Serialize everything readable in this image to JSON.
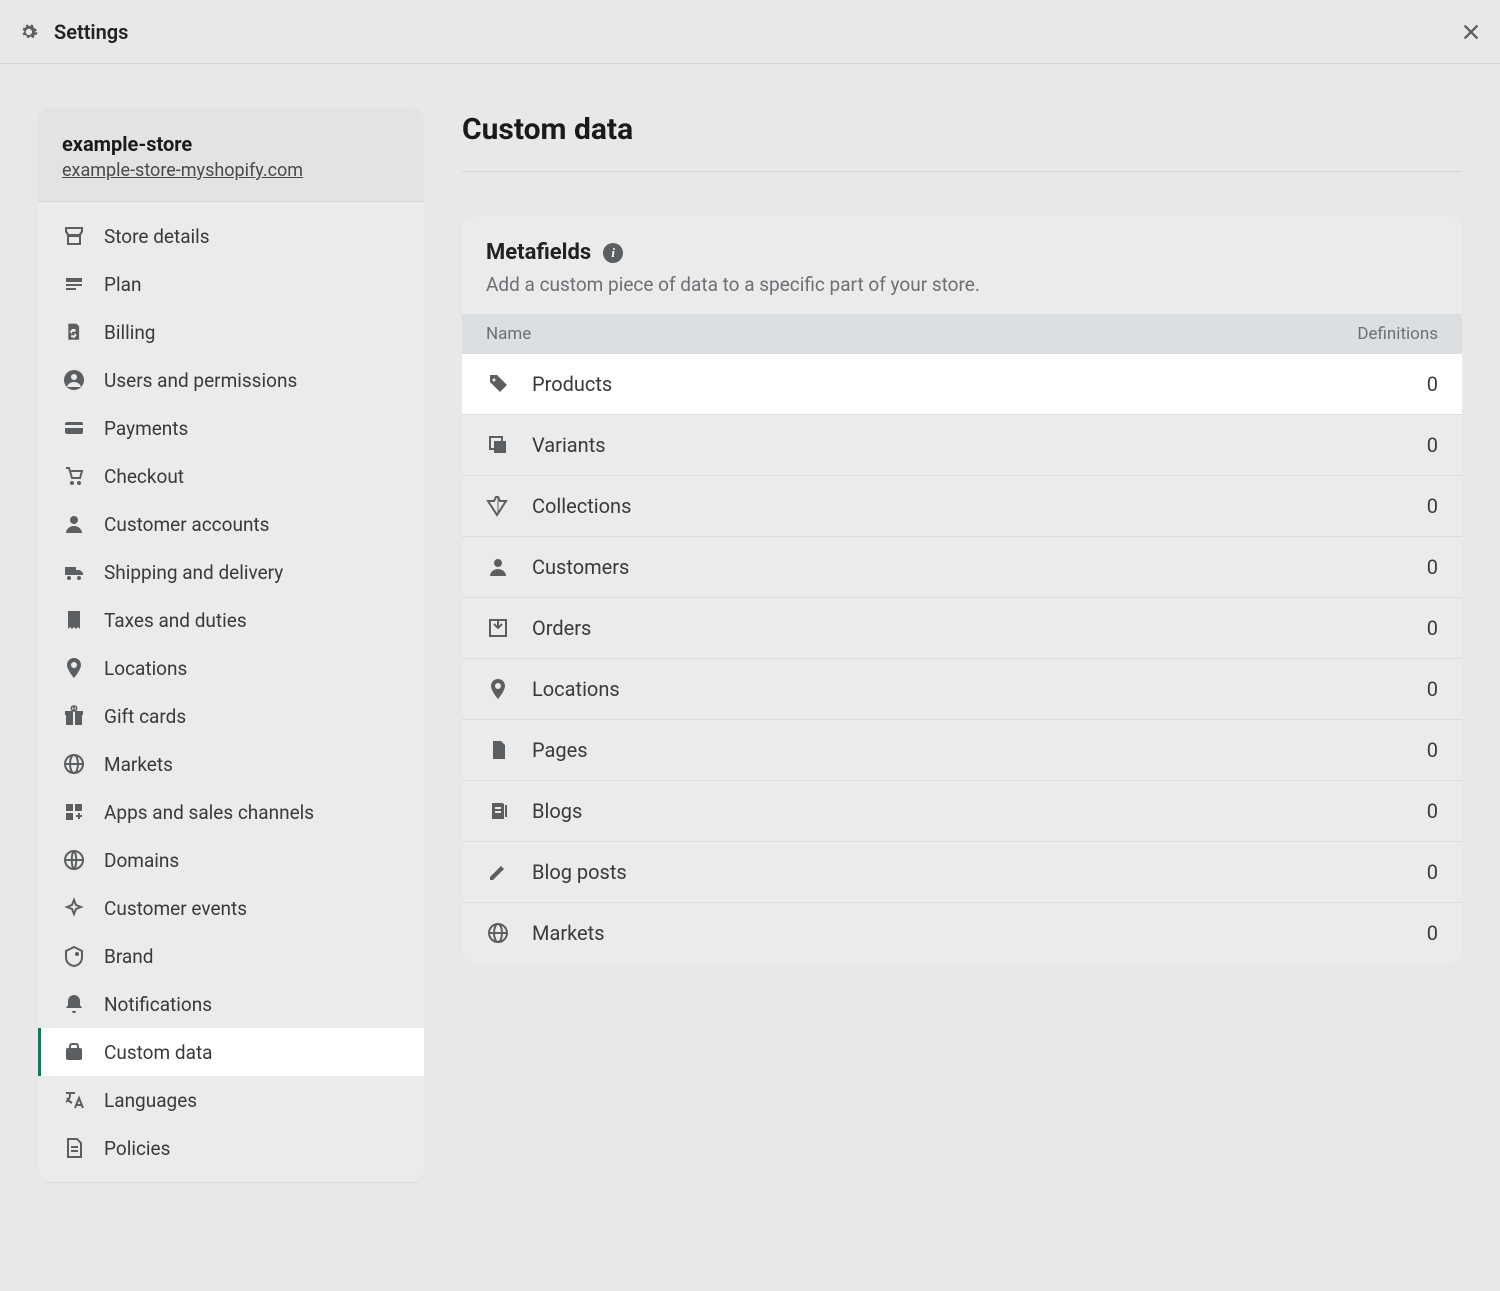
{
  "topbar": {
    "title": "Settings"
  },
  "store": {
    "name": "example-store",
    "url": "example-store-myshopify.com"
  },
  "sidebar": {
    "items": [
      {
        "id": "store-details",
        "label": "Store details",
        "icon": "store"
      },
      {
        "id": "plan",
        "label": "Plan",
        "icon": "plan"
      },
      {
        "id": "billing",
        "label": "Billing",
        "icon": "billing"
      },
      {
        "id": "users",
        "label": "Users and permissions",
        "icon": "user"
      },
      {
        "id": "payments",
        "label": "Payments",
        "icon": "card"
      },
      {
        "id": "checkout",
        "label": "Checkout",
        "icon": "cart"
      },
      {
        "id": "customer-accounts",
        "label": "Customer accounts",
        "icon": "person"
      },
      {
        "id": "shipping",
        "label": "Shipping and delivery",
        "icon": "truck"
      },
      {
        "id": "taxes",
        "label": "Taxes and duties",
        "icon": "receipt"
      },
      {
        "id": "locations",
        "label": "Locations",
        "icon": "pin"
      },
      {
        "id": "gift-cards",
        "label": "Gift cards",
        "icon": "gift"
      },
      {
        "id": "markets",
        "label": "Markets",
        "icon": "globe"
      },
      {
        "id": "apps",
        "label": "Apps and sales channels",
        "icon": "apps"
      },
      {
        "id": "domains",
        "label": "Domains",
        "icon": "domains"
      },
      {
        "id": "customer-events",
        "label": "Customer events",
        "icon": "sparkle"
      },
      {
        "id": "brand",
        "label": "Brand",
        "icon": "brand"
      },
      {
        "id": "notifications",
        "label": "Notifications",
        "icon": "bell"
      },
      {
        "id": "custom-data",
        "label": "Custom data",
        "icon": "data",
        "active": true
      },
      {
        "id": "languages",
        "label": "Languages",
        "icon": "lang"
      },
      {
        "id": "policies",
        "label": "Policies",
        "icon": "policies"
      }
    ]
  },
  "page": {
    "title": "Custom data"
  },
  "metafields": {
    "title": "Metafields",
    "subtitle": "Add a custom piece of data to a specific part of your store.",
    "columns": {
      "name": "Name",
      "definitions": "Definitions"
    },
    "rows": [
      {
        "id": "products",
        "label": "Products",
        "icon": "tag",
        "count": 0,
        "selected": true
      },
      {
        "id": "variants",
        "label": "Variants",
        "icon": "variants",
        "count": 0
      },
      {
        "id": "collections",
        "label": "Collections",
        "icon": "collections",
        "count": 0
      },
      {
        "id": "customers",
        "label": "Customers",
        "icon": "person",
        "count": 0
      },
      {
        "id": "orders",
        "label": "Orders",
        "icon": "inbox",
        "count": 0
      },
      {
        "id": "locations",
        "label": "Locations",
        "icon": "pin",
        "count": 0
      },
      {
        "id": "pages",
        "label": "Pages",
        "icon": "page",
        "count": 0
      },
      {
        "id": "blogs",
        "label": "Blogs",
        "icon": "blogs",
        "count": 0
      },
      {
        "id": "blog-posts",
        "label": "Blog posts",
        "icon": "pencil",
        "count": 0
      },
      {
        "id": "markets",
        "label": "Markets",
        "icon": "globe",
        "count": 0
      }
    ]
  }
}
